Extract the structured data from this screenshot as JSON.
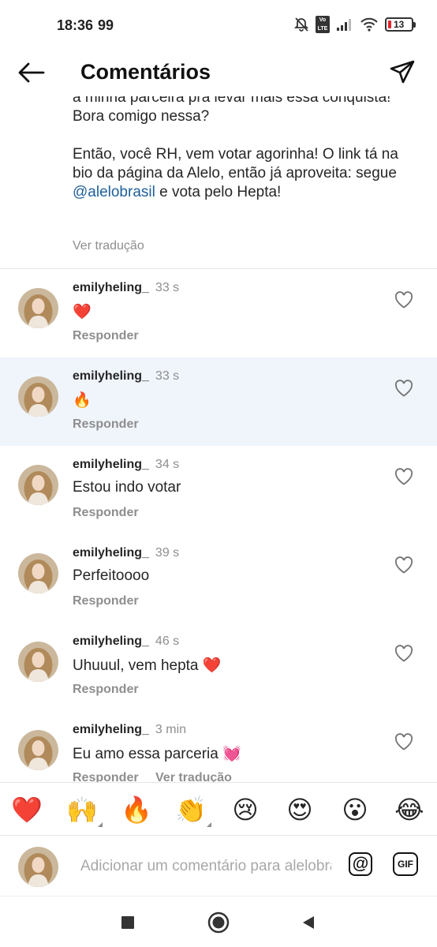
{
  "status": {
    "time": "18:36",
    "extra": "99",
    "battery": "13"
  },
  "header": {
    "title": "Comentários"
  },
  "caption": {
    "line1": "a minha parceira pra levar mais essa conquista! Bora comigo nessa?",
    "line2_before": "Então, você RH, vem votar agorinha! O link tá na bio da página da Alelo, então já aproveita: segue ",
    "mention": "@alelobrasil",
    "line2_after": " e vota pelo Hepta!",
    "see_translation": "Ver tradução"
  },
  "comments": [
    {
      "username": "emilyheling_",
      "time": "33 s",
      "text": "❤️",
      "reply": "Responder"
    },
    {
      "username": "emilyheling_",
      "time": "33 s",
      "text": "🔥",
      "reply": "Responder"
    },
    {
      "username": "emilyheling_",
      "time": "34 s",
      "text": "Estou indo votar",
      "reply": "Responder"
    },
    {
      "username": "emilyheling_",
      "time": "39 s",
      "text": "Perfeitoooo",
      "reply": "Responder"
    },
    {
      "username": "emilyheling_",
      "time": "46 s",
      "text": "Uhuuul, vem hepta ❤️",
      "reply": "Responder"
    },
    {
      "username": "emilyheling_",
      "time": "3 min",
      "text": "Eu amo essa parceria 💓",
      "reply": "Responder",
      "translate": "Ver tradução"
    }
  ],
  "emoji_bar": [
    "❤️",
    "🙌",
    "🔥",
    "👏",
    "😢",
    "😍",
    "😮",
    "😂"
  ],
  "composer": {
    "placeholder": "Adicionar um comentário para alelobrasil...",
    "mention_label": "@",
    "gif_label": "GIF"
  },
  "colors": {
    "mention": "#1e5f9a",
    "highlight": "#eff5fb",
    "muted": "#8e8e8e"
  }
}
